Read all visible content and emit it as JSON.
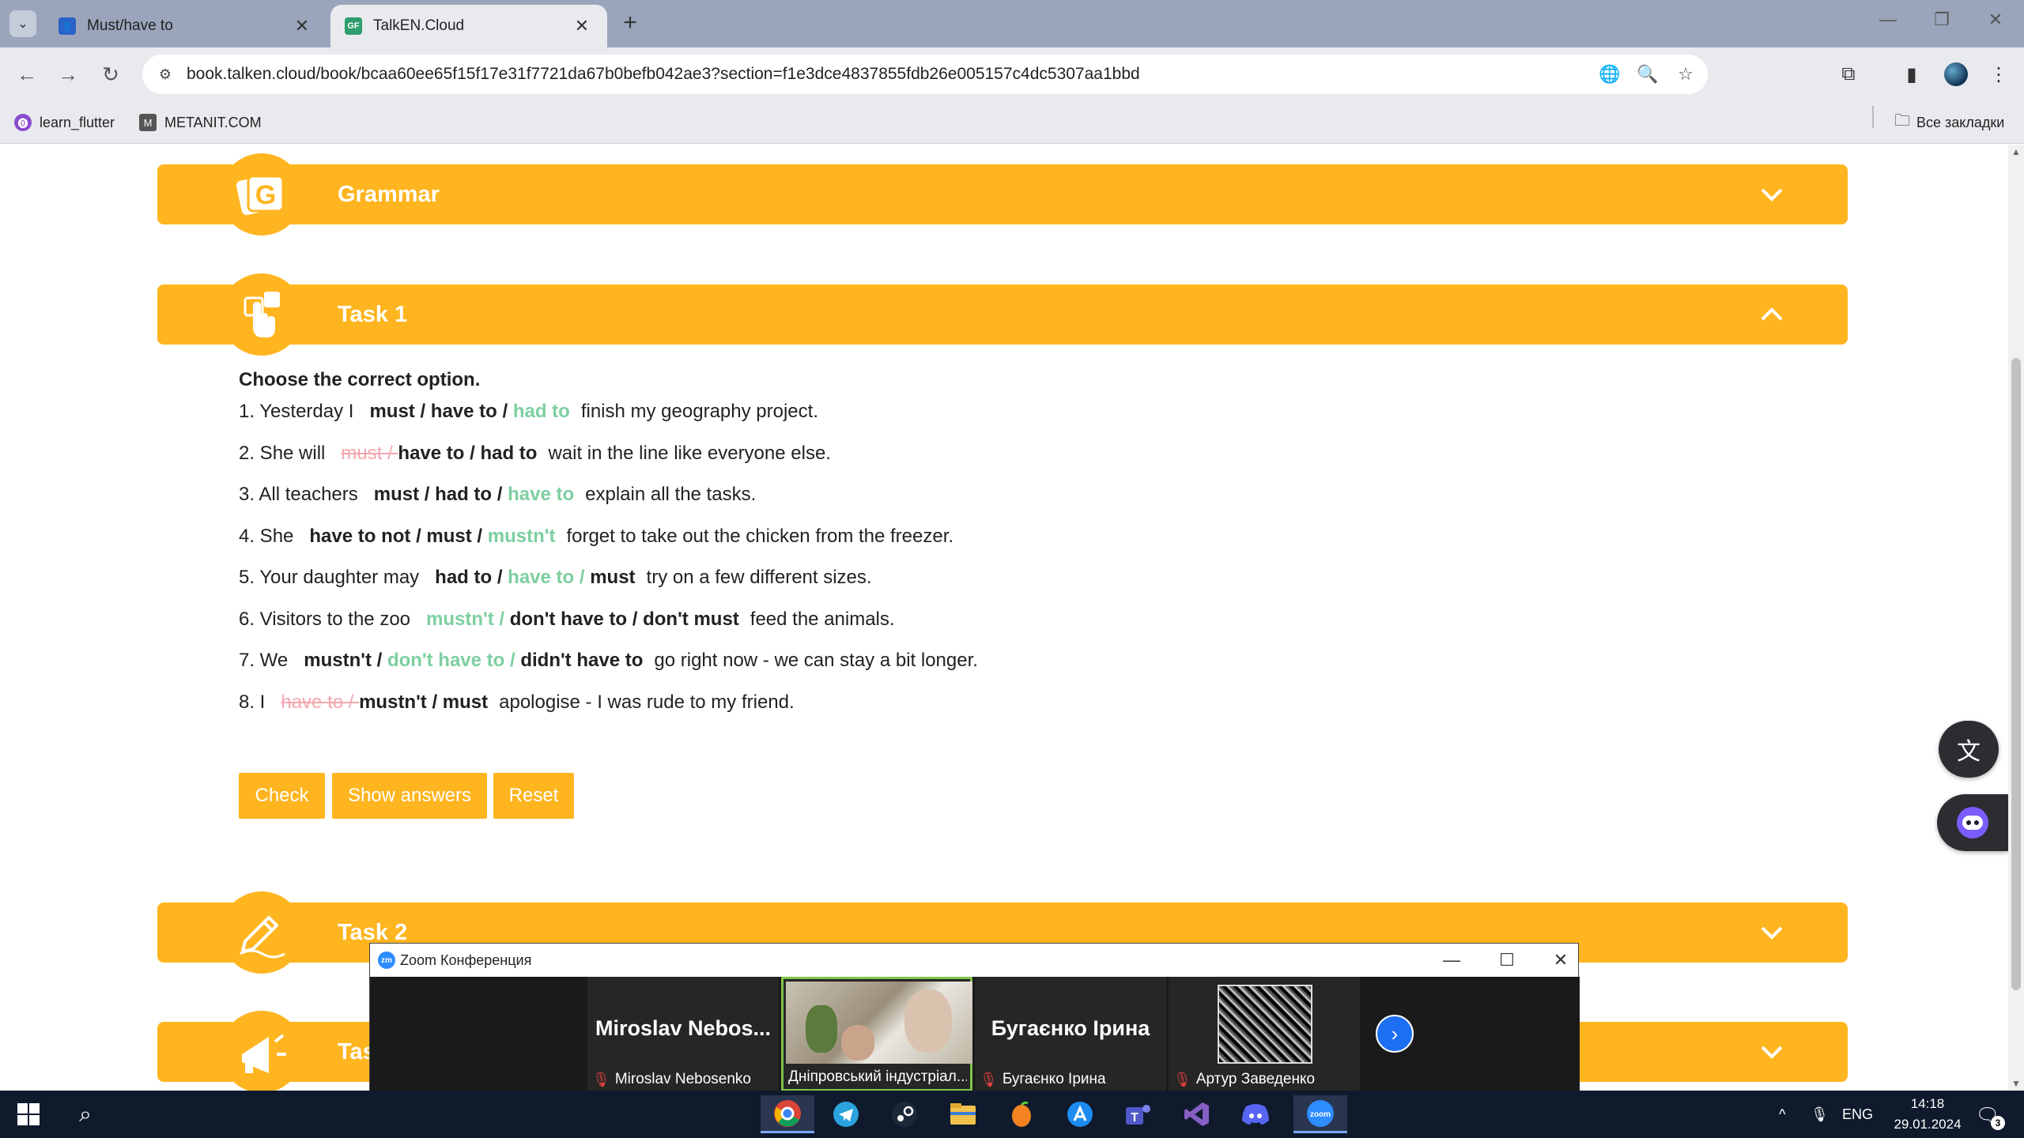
{
  "browser": {
    "tabs": [
      {
        "title": "Must/have to",
        "close": "✕"
      },
      {
        "title": "TalkEN.Cloud",
        "close": "✕",
        "favicon": "GF"
      }
    ],
    "new_tab": "+",
    "url": "book.talken.cloud/book/bcaa60ee65f15f17e31f7721da67b0befb042ae3?section=f1e3dce4837855fdb26e005157c4dc5307aa1bbd",
    "bookmarks": [
      {
        "label": "learn_flutter",
        "icon": "flutter-icon"
      },
      {
        "label": "METANIT.COM",
        "icon": "metanit-icon"
      }
    ],
    "all_bookmarks": "Все закладки"
  },
  "sections": {
    "grammar": {
      "title": "Grammar",
      "icon": "grammar-icon"
    },
    "task1": {
      "title": "Task 1",
      "icon": "touch-icon"
    },
    "task2": {
      "title": "Task 2",
      "icon": "pen-icon"
    },
    "task3": {
      "title": "Tas",
      "icon": "megaphone-icon"
    }
  },
  "task1": {
    "instruction": "Choose the correct option.",
    "sentences": [
      {
        "prefix": "1. Yesterday I",
        "options": [
          {
            "text": "must / ",
            "state": "normal"
          },
          {
            "text": "have to / ",
            "state": "normal"
          },
          {
            "text": "had to",
            "state": "selected"
          }
        ],
        "suffix": "finish my geography project."
      },
      {
        "prefix": "2. She will",
        "options": [
          {
            "text": "must / ",
            "state": "wrong"
          },
          {
            "text": "have to / ",
            "state": "normal"
          },
          {
            "text": "had to",
            "state": "normal"
          }
        ],
        "suffix": "wait in the line like everyone else."
      },
      {
        "prefix": "3. All teachers",
        "options": [
          {
            "text": "must / ",
            "state": "normal"
          },
          {
            "text": "had to / ",
            "state": "normal"
          },
          {
            "text": "have to",
            "state": "selected"
          }
        ],
        "suffix": "explain all the tasks."
      },
      {
        "prefix": "4. She",
        "options": [
          {
            "text": "have to not / ",
            "state": "normal"
          },
          {
            "text": "must / ",
            "state": "normal"
          },
          {
            "text": "mustn't",
            "state": "selected"
          }
        ],
        "suffix": "forget to take out the chicken from the freezer."
      },
      {
        "prefix": "5. Your daughter may",
        "options": [
          {
            "text": "had to / ",
            "state": "normal"
          },
          {
            "text": "have to / ",
            "state": "selected"
          },
          {
            "text": "must",
            "state": "normal"
          }
        ],
        "suffix": "try on a few different sizes."
      },
      {
        "prefix": "6. Visitors to the zoo",
        "options": [
          {
            "text": "mustn't / ",
            "state": "selected"
          },
          {
            "text": "don't have to / ",
            "state": "normal"
          },
          {
            "text": "don't must",
            "state": "normal"
          }
        ],
        "suffix": "feed the animals."
      },
      {
        "prefix": "7. We",
        "options": [
          {
            "text": "mustn't / ",
            "state": "normal"
          },
          {
            "text": "don't have to / ",
            "state": "selected"
          },
          {
            "text": "didn't have to",
            "state": "normal"
          }
        ],
        "suffix": "go right now - we can stay a bit longer."
      },
      {
        "prefix": "8. I",
        "options": [
          {
            "text": "have to / ",
            "state": "wrong"
          },
          {
            "text": "mustn't / ",
            "state": "normal"
          },
          {
            "text": "must",
            "state": "normal"
          }
        ],
        "suffix": "apologise - I was rude to my friend."
      }
    ],
    "buttons": {
      "check": "Check",
      "show_answers": "Show answers",
      "reset": "Reset"
    }
  },
  "zoom": {
    "title": "Zoom Конференция",
    "logo": "zm",
    "participants": [
      {
        "big_name": "Miroslav  Nebos...",
        "label": "Miroslav Nebosenko",
        "muted": true
      },
      {
        "label": "Дніпровський індустріал...",
        "muted": false,
        "video": true
      },
      {
        "big_name": "Бугаєнко Ірина",
        "label": "Бугаєнко Ірина",
        "muted": true
      },
      {
        "label": "Артур Заведенко",
        "muted": true,
        "art": true
      }
    ]
  },
  "taskbar": {
    "apps": [
      "chrome-icon",
      "telegram-icon",
      "steam-icon",
      "explorer-icon",
      "fl-studio-icon",
      "app-store-icon",
      "teams-icon",
      "visual-studio-icon",
      "discord-icon",
      "zoom-icon"
    ],
    "lang": "ENG",
    "time": "14:18",
    "date": "29.01.2024",
    "notifications": "3"
  },
  "colors": {
    "accent": "#ffb51f",
    "selected": "#7dcfa0",
    "wrong": "#f3a7b0",
    "zoom_blue": "#1d6ff2"
  }
}
